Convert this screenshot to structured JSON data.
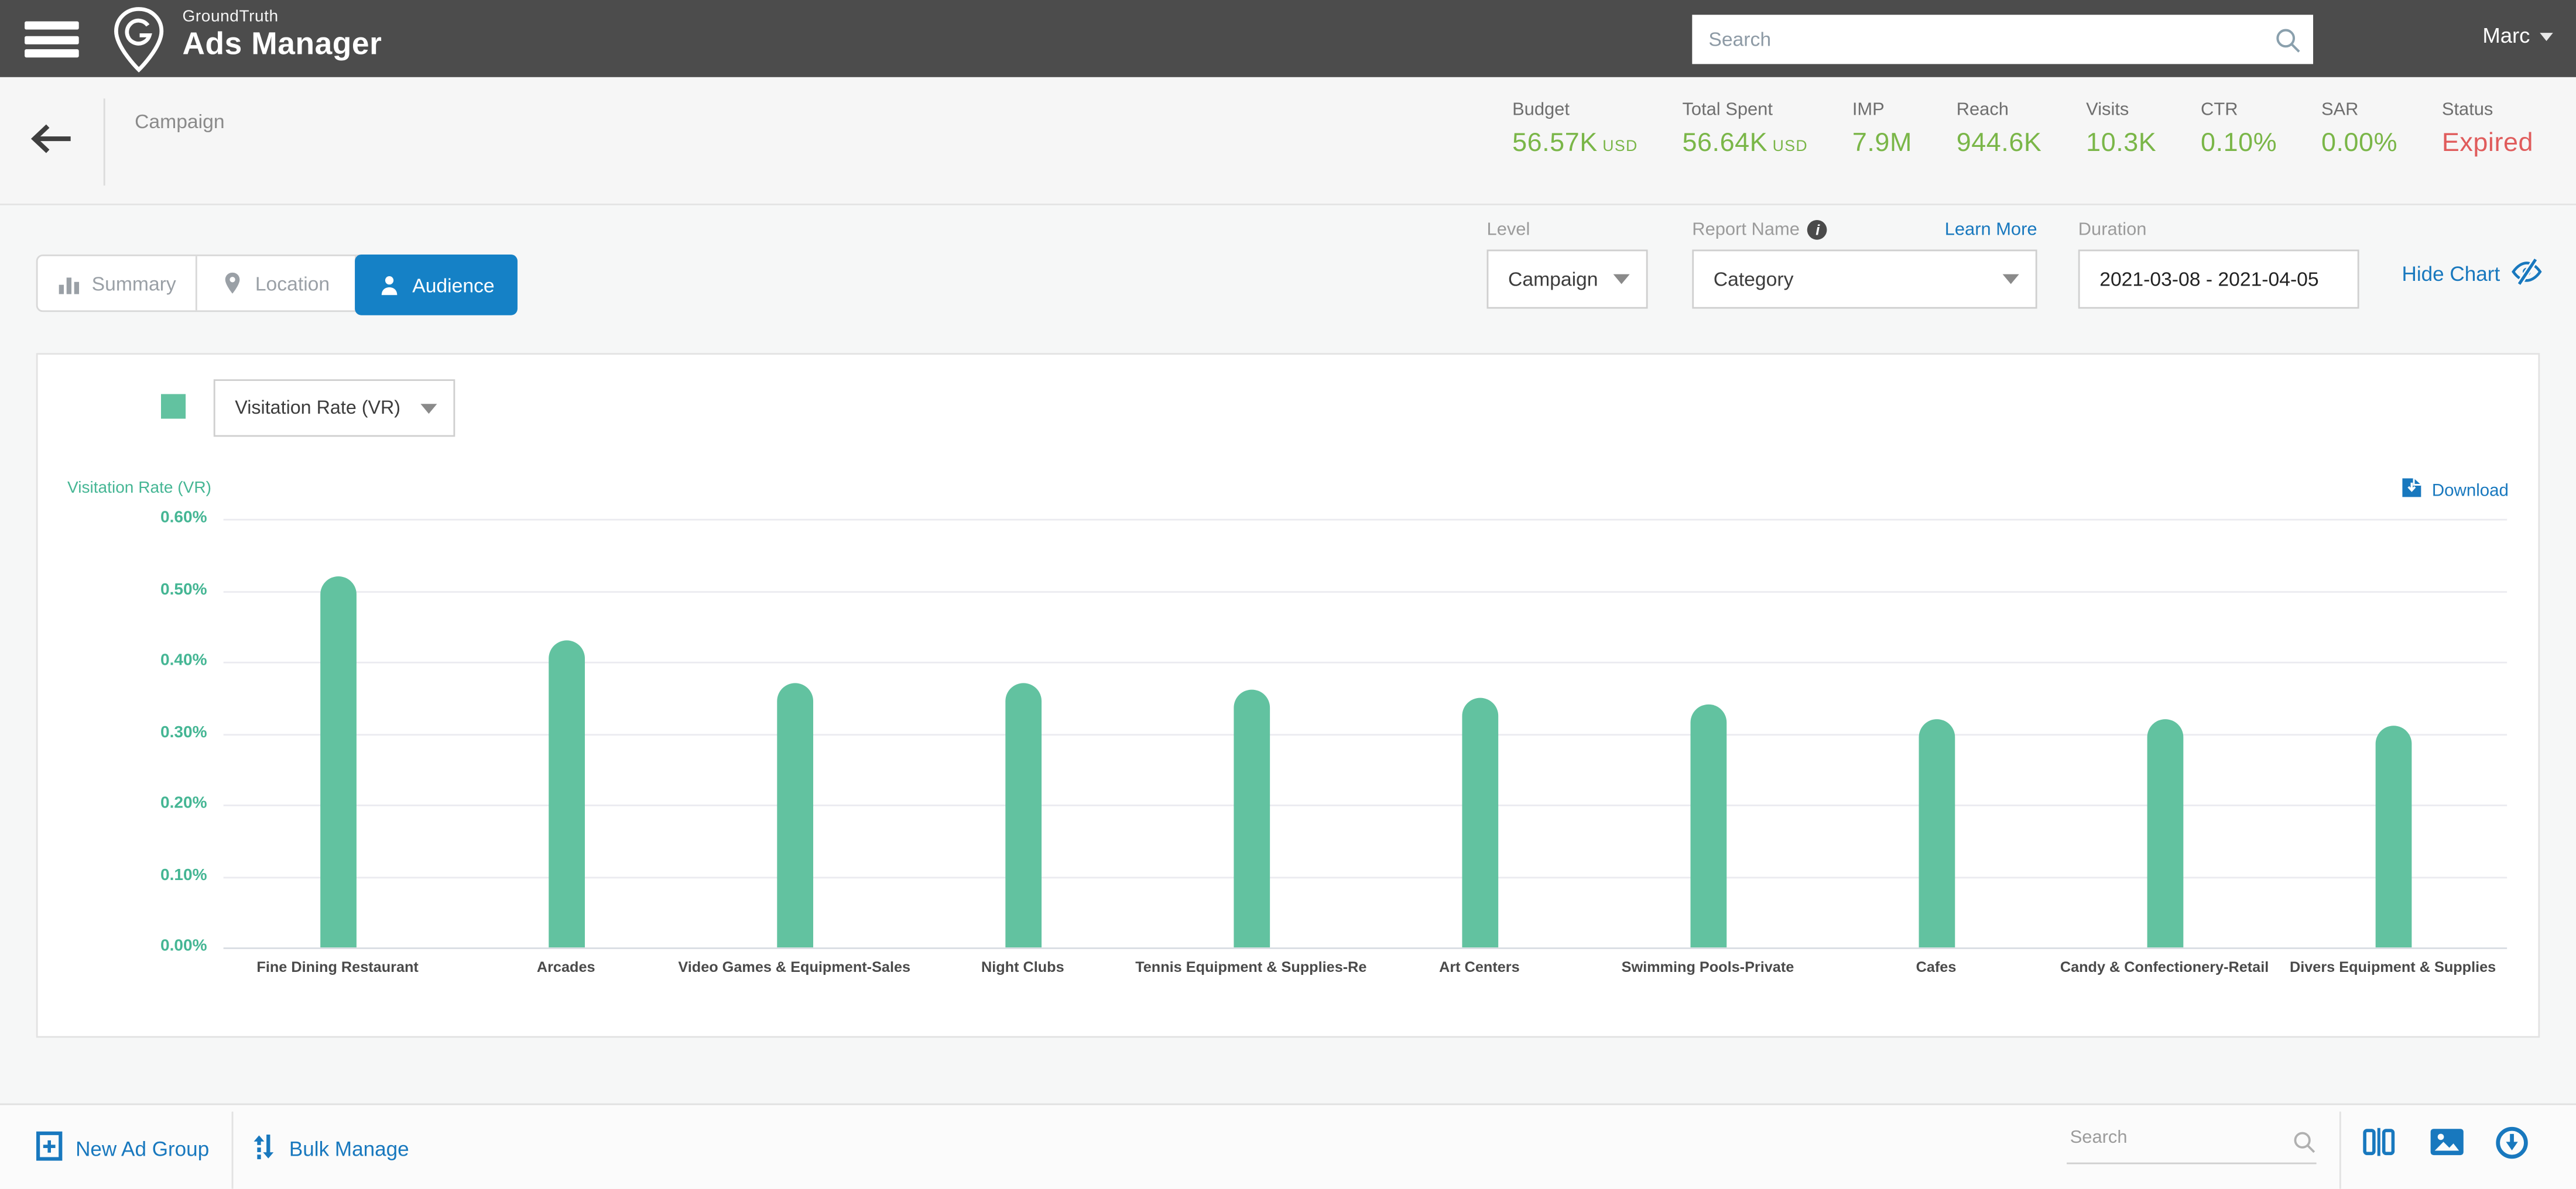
{
  "header": {
    "brand_small": "GroundTruth",
    "brand_large": "Ads Manager",
    "search_placeholder": "Search",
    "user": "Marc"
  },
  "campaign_bar": {
    "title": "Campaign",
    "stats": [
      {
        "label": "Budget",
        "value": "56.57K",
        "suffix": "USD",
        "value_color": "#7ab648"
      },
      {
        "label": "Total Spent",
        "value": "56.64K",
        "suffix": "USD",
        "value_color": "#7ab648"
      },
      {
        "label": "IMP",
        "value": "7.9M",
        "suffix": "",
        "value_color": "#7ab648"
      },
      {
        "label": "Reach",
        "value": "944.6K",
        "suffix": "",
        "value_color": "#7ab648"
      },
      {
        "label": "Visits",
        "value": "10.3K",
        "suffix": "",
        "value_color": "#7ab648"
      },
      {
        "label": "CTR",
        "value": "0.10%",
        "suffix": "",
        "value_color": "#7ab648"
      },
      {
        "label": "SAR",
        "value": "0.00%",
        "suffix": "",
        "value_color": "#7ab648"
      },
      {
        "label": "Status",
        "value": "Expired",
        "suffix": "",
        "value_color": "#e05c5c"
      }
    ]
  },
  "tabs": [
    {
      "label": "Summary",
      "icon": "bar-chart-icon",
      "active": false
    },
    {
      "label": "Location",
      "icon": "map-pin-icon",
      "active": false
    },
    {
      "label": "Audience",
      "icon": "person-icon",
      "active": true
    }
  ],
  "controls": {
    "level_label": "Level",
    "level_value": "Campaign",
    "report_name_label": "Report Name",
    "report_info_icon": "info-icon",
    "learn_more": "Learn More",
    "report_name_value": "Category",
    "duration_label": "Duration",
    "duration_value": "2021-03-08 - 2021-04-05",
    "hide_chart": "Hide Chart",
    "hide_chart_icon": "eye-slash-icon"
  },
  "chart": {
    "legend_metric": "Visitation Rate (VR)",
    "axis_title": "Visitation Rate (VR)",
    "download_label": "Download",
    "download_icon": "file-download-icon"
  },
  "chart_data": {
    "type": "bar",
    "title": "",
    "xlabel": "",
    "ylabel": "Visitation Rate (VR)",
    "categories": [
      "Fine Dining Restaurant",
      "Arcades",
      "Video Games & Equipment-Sales",
      "Night Clubs",
      "Tennis Equipment & Supplies-Re",
      "Art Centers",
      "Swimming Pools-Private",
      "Cafes",
      "Candy & Confectionery-Retail",
      "Divers Equipment & Supplies"
    ],
    "values": [
      0.52,
      0.43,
      0.37,
      0.37,
      0.36,
      0.35,
      0.34,
      0.32,
      0.32,
      0.31
    ],
    "value_unit": "%",
    "yticks": [
      "0.60%",
      "0.50%",
      "0.40%",
      "0.30%",
      "0.20%",
      "0.10%",
      "0.00%"
    ],
    "ylim": [
      0,
      0.6
    ],
    "grid": true,
    "legend_position": "top-left",
    "series_color": "#62c2a0"
  },
  "footer": {
    "new_ad_group": "New Ad Group",
    "new_ad_group_icon": "plus-box-icon",
    "bulk_manage": "Bulk Manage",
    "bulk_manage_icon": "sort-arrows-icon",
    "search_placeholder": "Search",
    "action_icons": [
      "columns-icon",
      "image-icon",
      "download-circle-icon"
    ]
  },
  "colors": {
    "header_bg": "#4c4c4c",
    "accent_blue": "#1581c6",
    "link_blue": "#1878be",
    "stat_green": "#7ab648",
    "status_red": "#e05c5c",
    "bar_green": "#62c2a0",
    "axis_teal": "#45b694"
  }
}
